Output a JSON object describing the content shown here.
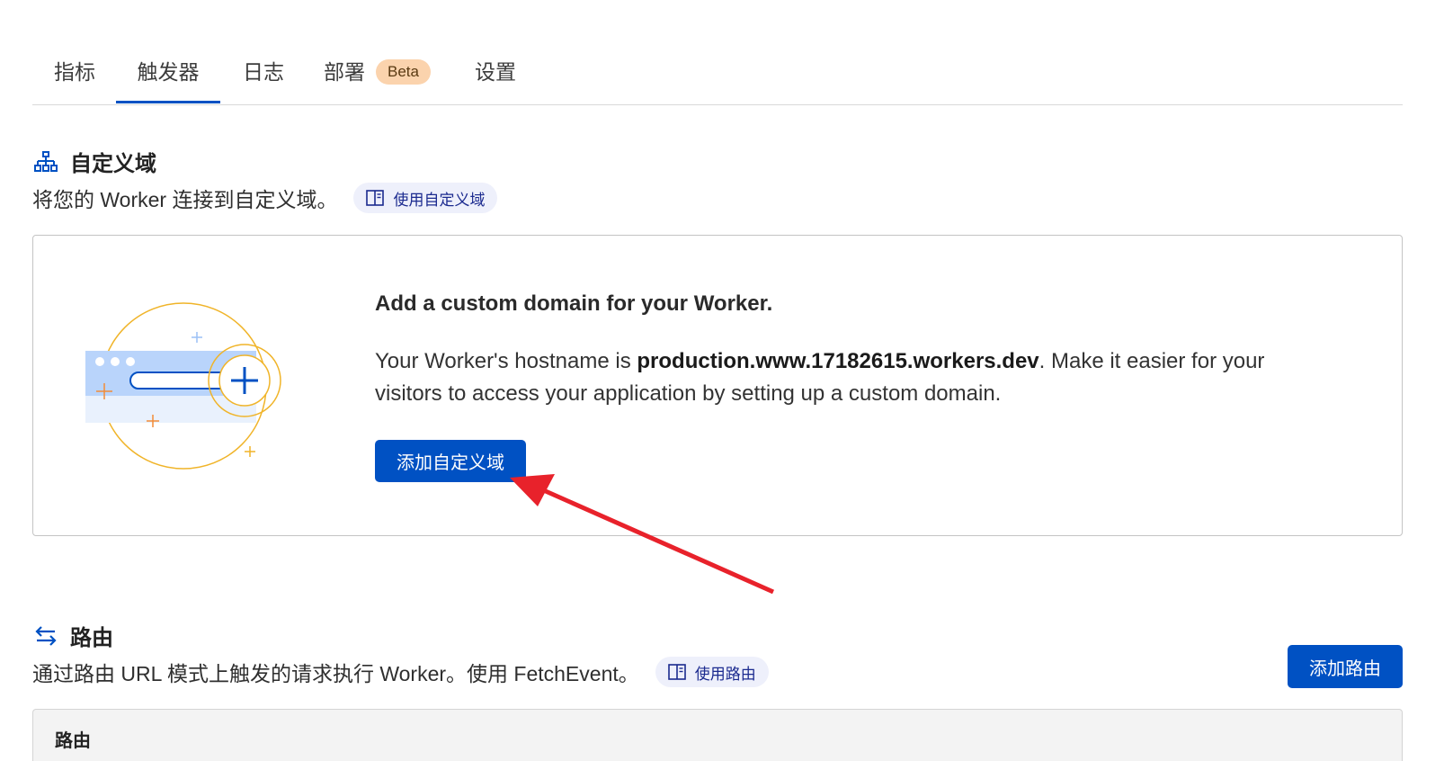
{
  "tabs": [
    {
      "label": "指标"
    },
    {
      "label": "触发器"
    },
    {
      "label": "日志"
    },
    {
      "label": "部署",
      "badge": "Beta"
    },
    {
      "label": "设置"
    }
  ],
  "active_tab": "触发器",
  "custom_domain": {
    "title": "自定义域",
    "description": "将您的 Worker 连接到自定义域。",
    "doc_link": "使用自定义域",
    "card": {
      "heading": "Add a custom domain for your Worker.",
      "body_before": "Your Worker's hostname is ",
      "hostname": "production.www.17182615.workers.dev",
      "body_after": ". Make it easier for your visitors to access your application by setting up a custom domain.",
      "button": "添加自定义域"
    }
  },
  "routes": {
    "title": "路由",
    "description": "通过路由 URL 模式上触发的请求执行 Worker。使用 FetchEvent。",
    "doc_link": "使用路由",
    "add_button": "添加路由",
    "table_header": "路由"
  },
  "colors": {
    "accent": "#0051c3",
    "badge_bg": "#fbd3ad",
    "annotation_arrow": "#e8222b"
  }
}
